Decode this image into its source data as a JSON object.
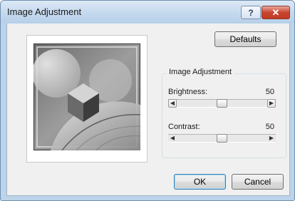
{
  "window": {
    "title": "Image Adjustment"
  },
  "titlebar": {
    "help_label": "?",
    "close_label": "✕"
  },
  "buttons": {
    "defaults": "Defaults",
    "ok": "OK",
    "cancel": "Cancel"
  },
  "group": {
    "label": "Image Adjustment"
  },
  "sliders": [
    {
      "label": "Brightness:",
      "value": "50",
      "position": 0.5,
      "left_arrow": "◀",
      "right_arrow": "▶"
    },
    {
      "label": "Contrast:",
      "value": "50",
      "position": 0.5,
      "left_arrow": "◀",
      "right_arrow": "▶"
    }
  ],
  "colors": {
    "title_bar": "#c4d9ee",
    "dialog_bg": "#f0f0f0",
    "close_button": "#c9462f",
    "default_button_border": "#3c7fb1"
  }
}
